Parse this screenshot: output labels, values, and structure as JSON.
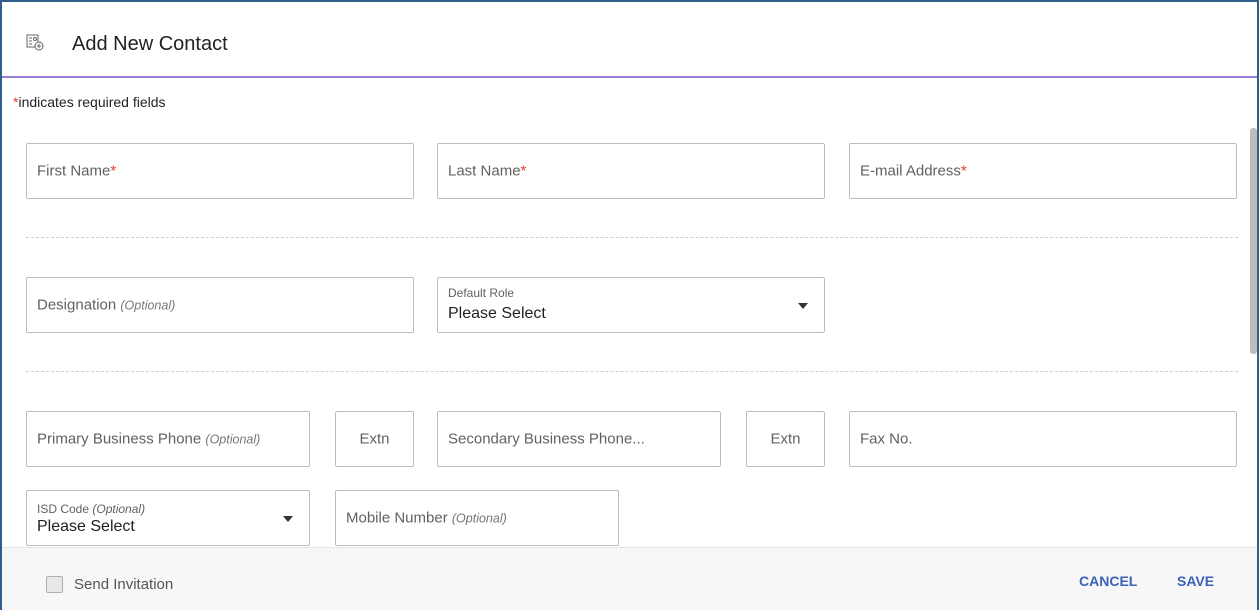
{
  "dialog": {
    "title": "Add New Contact",
    "header_icon": "contact-card-add-icon"
  },
  "required_note": {
    "star": "*",
    "text": "indicates required fields"
  },
  "fields": {
    "first_name": {
      "label": "First Name",
      "star": "*"
    },
    "last_name": {
      "label": "Last Name",
      "star": "*"
    },
    "email": {
      "label": "E-mail Address",
      "star": "*"
    },
    "designation": {
      "label": "Designation",
      "optional": "(Optional)"
    },
    "default_role": {
      "label": "Default Role",
      "value": "Please Select"
    },
    "primary_phone": {
      "label": "Primary Business Phone",
      "optional": "(Optional)"
    },
    "primary_extn": {
      "label": "Extn"
    },
    "secondary_phone": {
      "label": "Secondary Business Phone..."
    },
    "secondary_extn": {
      "label": "Extn"
    },
    "fax": {
      "label": "Fax No."
    },
    "isd_code": {
      "label": "ISD Code",
      "optional": "(Optional)",
      "value": "Please Select"
    },
    "mobile": {
      "label": "Mobile Number",
      "optional": "(Optional)"
    }
  },
  "footer": {
    "send_invitation": "Send Invitation",
    "send_invitation_checked": false,
    "cancel": "CANCEL",
    "save": "SAVE"
  },
  "colors": {
    "accent": "#3a62b8",
    "required": "#e53935",
    "header_rule": "#9b7fd6",
    "frame": "#2f5f8a"
  }
}
